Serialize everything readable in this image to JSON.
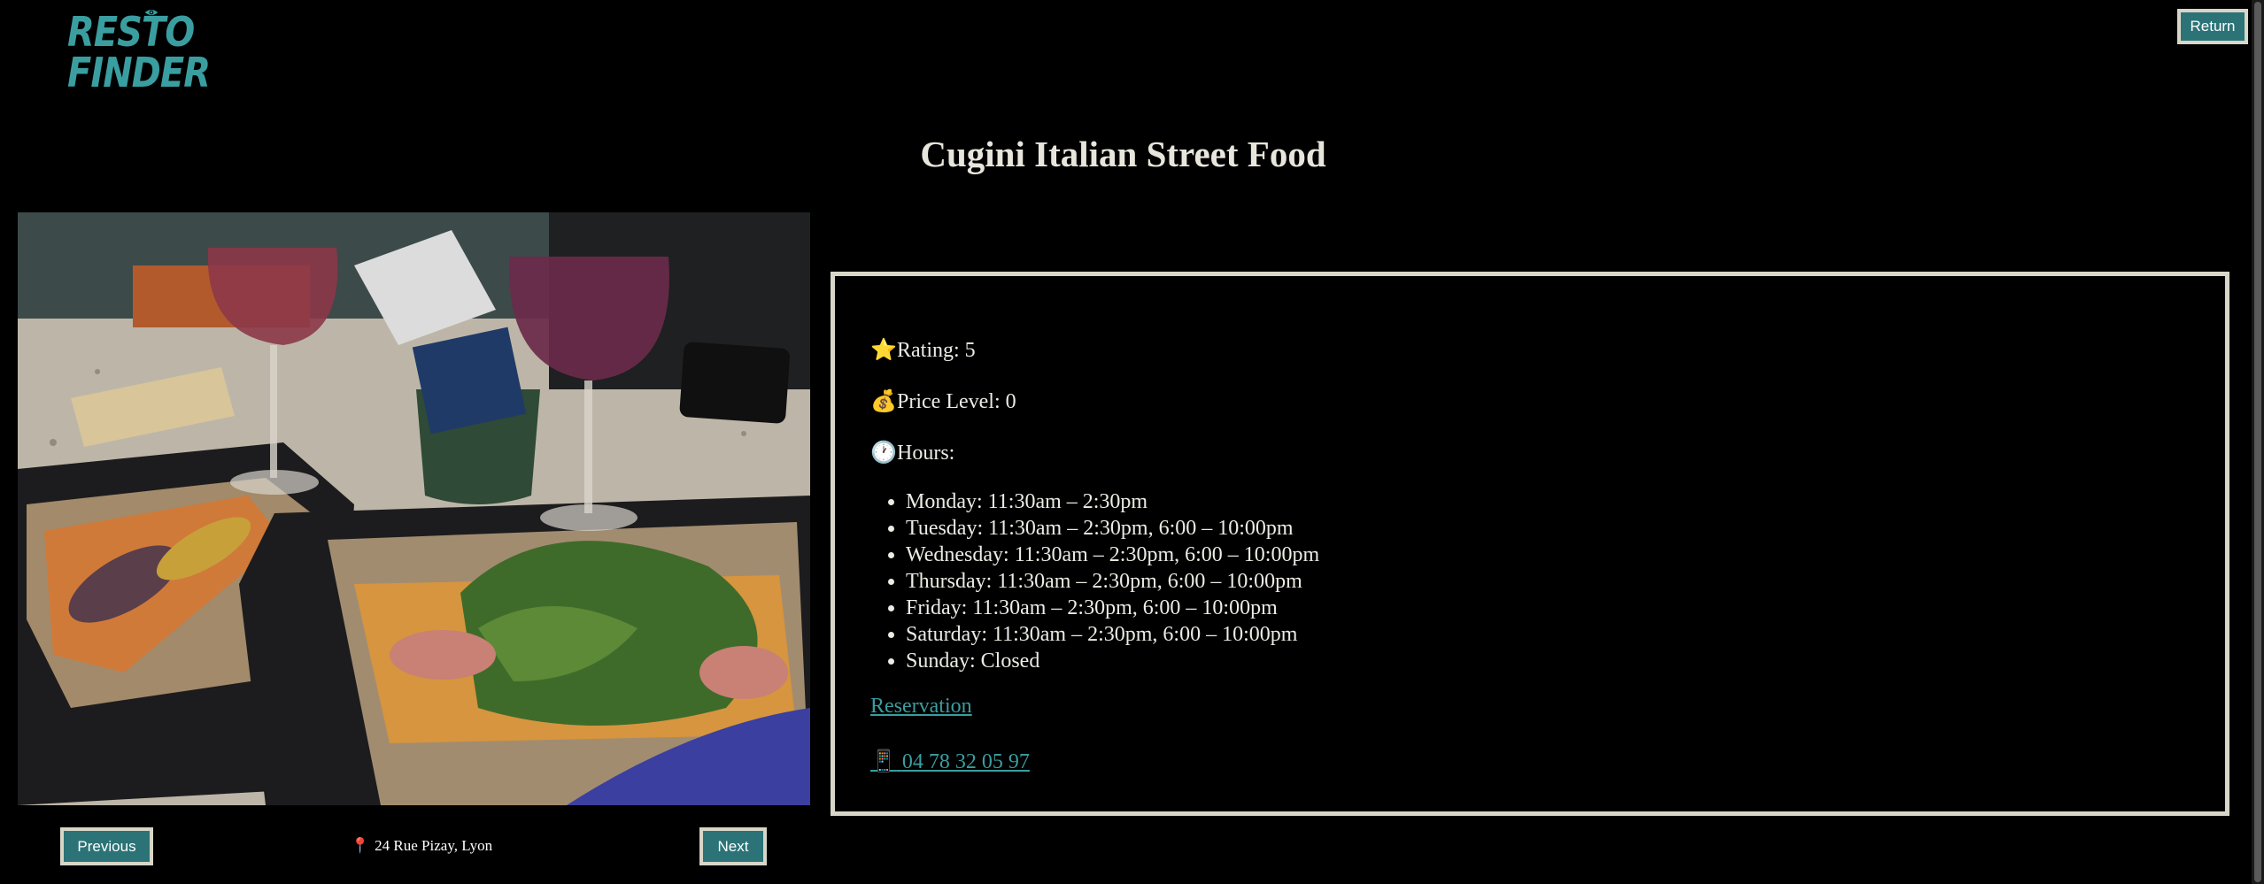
{
  "brand": {
    "logo_text": "RESTO FINDER",
    "accent": "#3a9ea0"
  },
  "header": {
    "return_label": "Return"
  },
  "restaurant": {
    "name": "Cugini Italian Street Food",
    "rating_label": "Rating: 5",
    "price_label": "Price Level: 0",
    "hours_label": "Hours:",
    "hours": [
      "Monday: 11:30am – 2:30pm",
      "Tuesday: 11:30am – 2:30pm, 6:00 – 10:00pm",
      "Wednesday: 11:30am – 2:30pm, 6:00 – 10:00pm",
      "Thursday: 11:30am – 2:30pm, 6:00 – 10:00pm",
      "Friday: 11:30am – 2:30pm, 6:00 – 10:00pm",
      "Saturday: 11:30am – 2:30pm, 6:00 – 10:00pm",
      "Sunday: Closed"
    ],
    "reservation_label": "Reservation",
    "phone": "04 78 32 05 97",
    "address": "24 Rue Pizay, Lyon",
    "icons": {
      "rating": "star-icon",
      "price": "money-bag-icon",
      "hours": "clock-icon",
      "phone": "phone-icon",
      "address": "pin-icon"
    }
  },
  "gallery": {
    "prev_label": "Previous",
    "next_label": "Next"
  }
}
